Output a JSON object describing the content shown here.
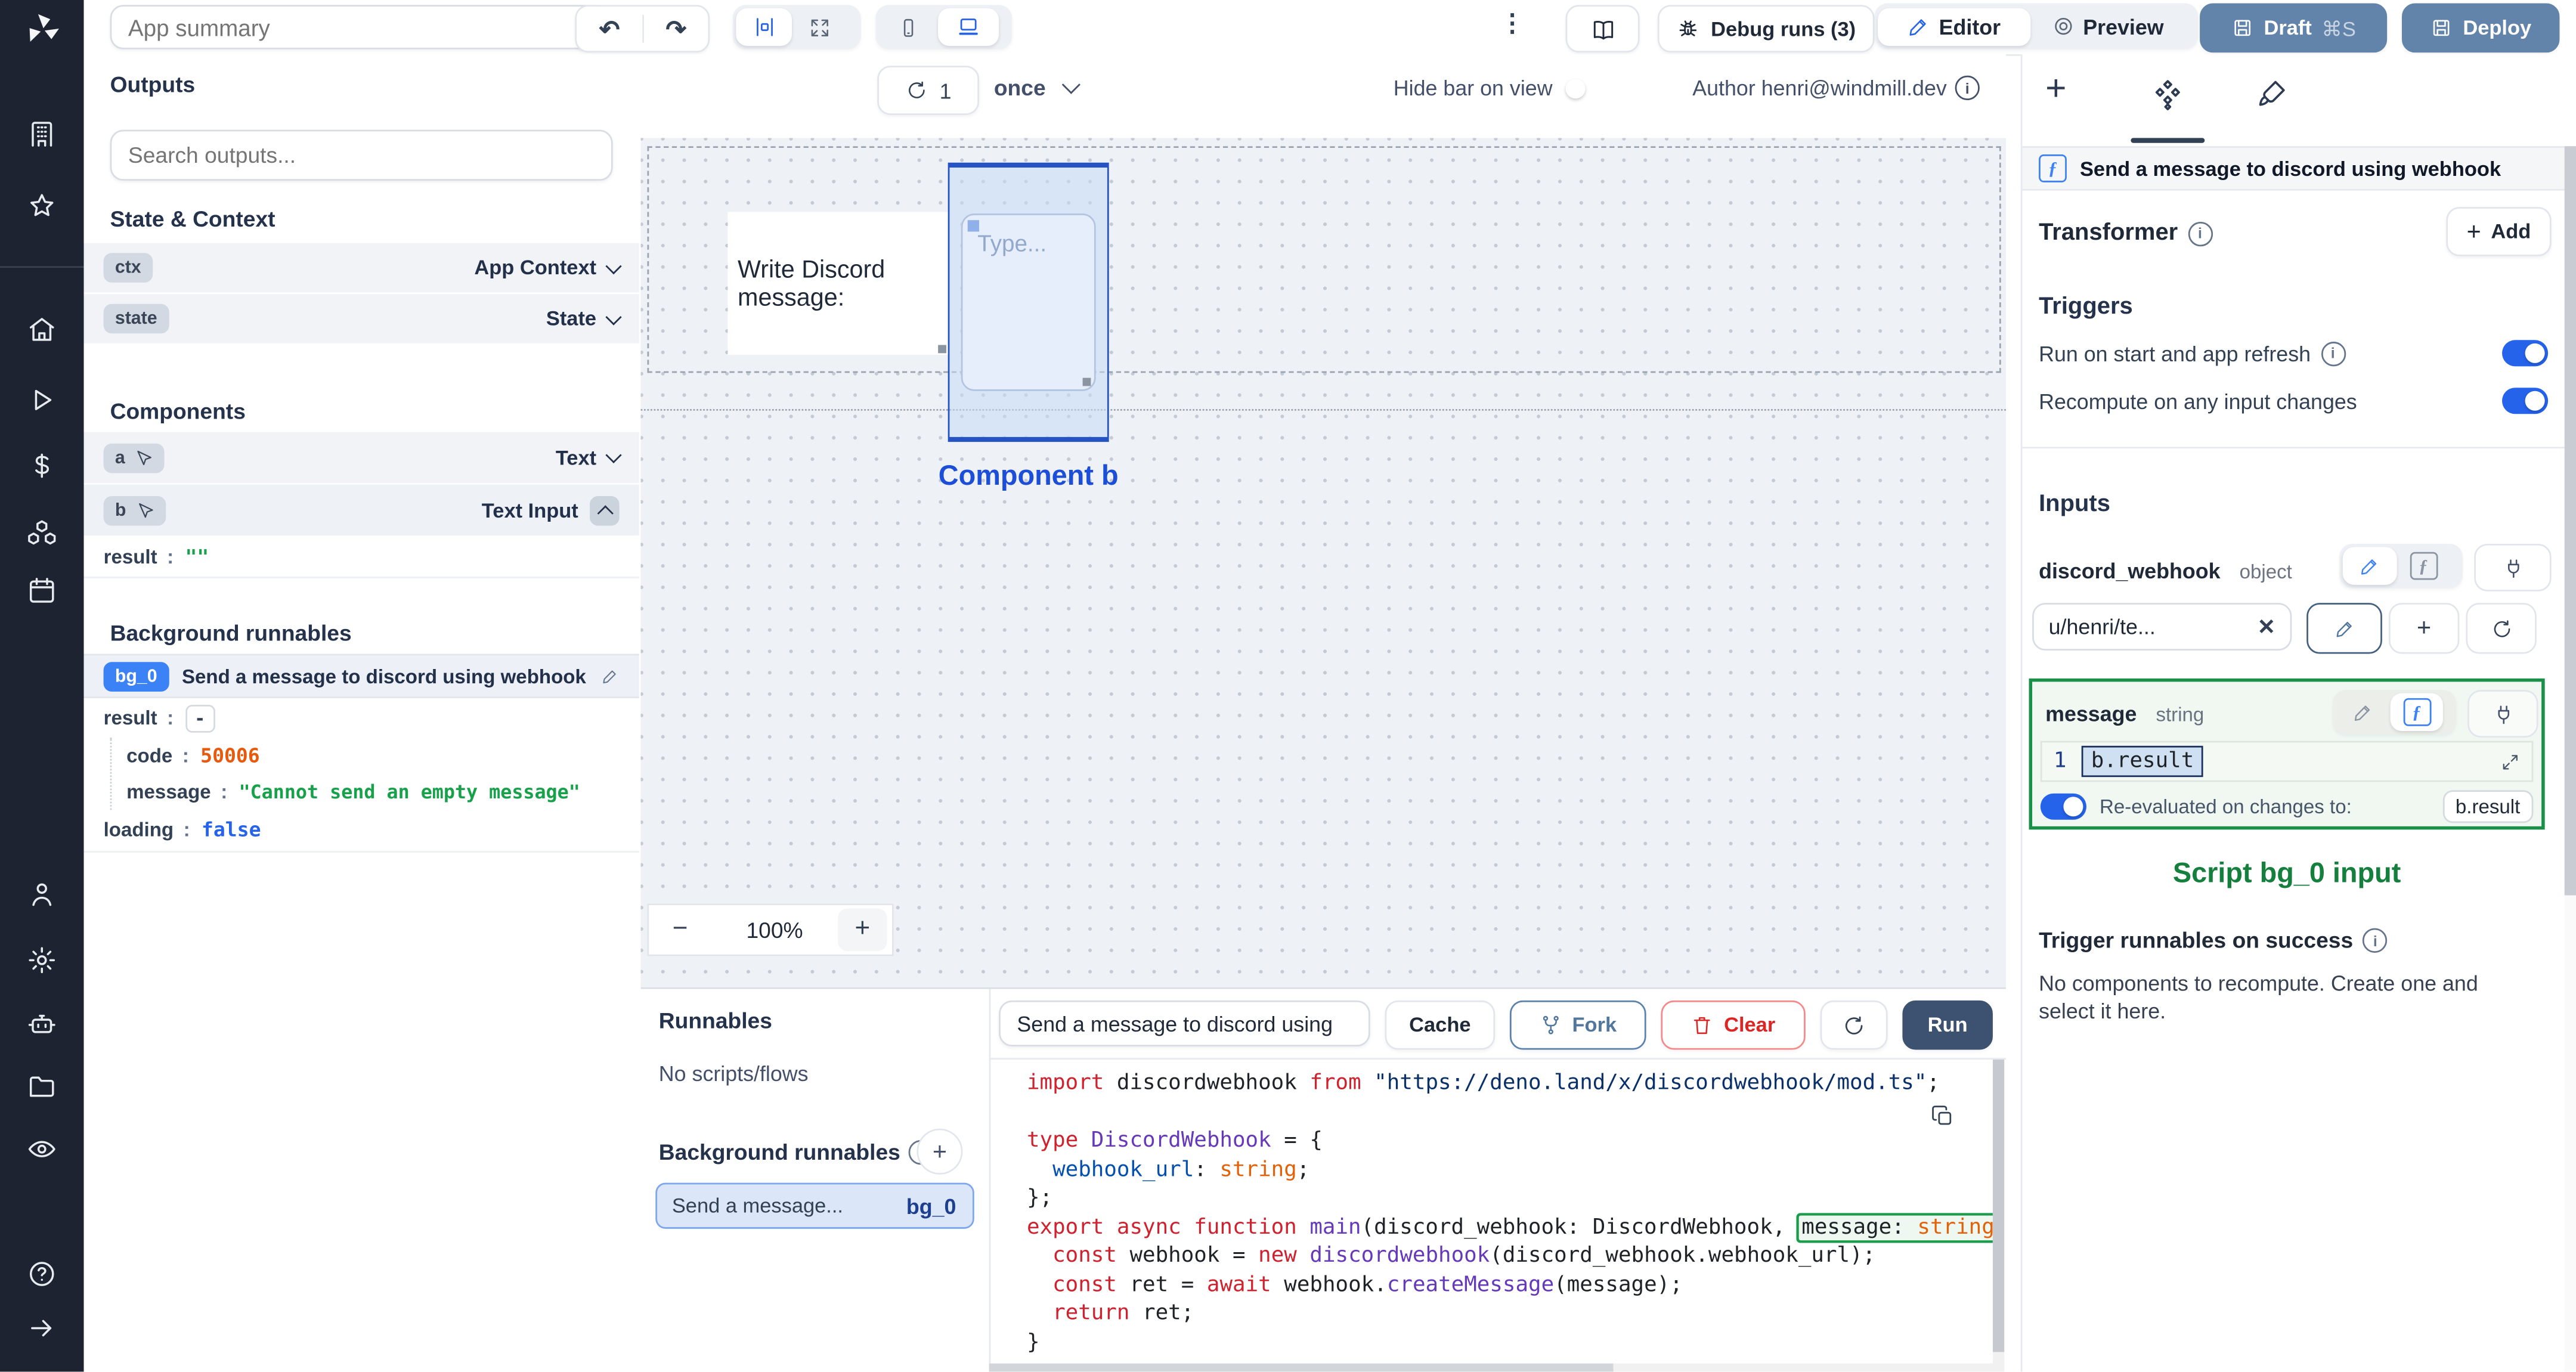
{
  "colors": {
    "accent": "#2563eb",
    "rail_bg": "#1d2330",
    "steel_button": "#6284aa",
    "run_button": "#3d5270",
    "selection_blue": "#2653c3",
    "green_accent": "#15803d",
    "badge_blue": "#3b82f6",
    "value_orange": "#e8590c",
    "value_green": "#18a14b",
    "value_bool_blue": "#2563eb",
    "canvas_bg": "#eef1f5"
  },
  "icons": [
    "windmill-logo-icon",
    "building-icon",
    "star-icon",
    "home-icon",
    "play-icon",
    "dollar-icon",
    "cubes-icon",
    "calendar-icon",
    "user-icon",
    "gear-icon",
    "robot-icon",
    "folder-icon",
    "eye-icon",
    "help-icon",
    "arrow-right-icon",
    "undo-icon",
    "redo-icon",
    "align-center-icon",
    "expand-icon",
    "phone-icon",
    "laptop-icon",
    "kebab-icon",
    "book-icon",
    "bug-icon",
    "pencil-icon",
    "target-icon",
    "save-icon",
    "refresh-icon",
    "chevron-down-icon",
    "chevron-up-icon",
    "pointer-icon",
    "plus-icon",
    "components-icon",
    "brush-icon",
    "function-icon",
    "plug-icon",
    "close-icon",
    "fork-icon",
    "trash-icon",
    "copy-icon",
    "expand-diagonal-icon",
    "info-icon"
  ],
  "topbar": {
    "app_summary_placeholder": "App summary",
    "debug_runs_label": "Debug runs (3)",
    "editor_label": "Editor",
    "preview_label": "Preview",
    "draft_label": "Draft",
    "draft_shortcut": "⌘S",
    "deploy_label": "Deploy"
  },
  "outputs": {
    "title": "Outputs",
    "search_placeholder": "Search outputs...",
    "state_context_title": "State & Context",
    "ctx": {
      "key": "ctx",
      "type": "App Context"
    },
    "state": {
      "key": "state",
      "type": "State"
    },
    "components_title": "Components",
    "comp_a": {
      "key": "a",
      "type": "Text"
    },
    "comp_b": {
      "key": "b",
      "type": "Text Input"
    },
    "b_result": {
      "key": "result",
      "value": "\"\""
    },
    "background_title": "Background runnables",
    "bg0": {
      "badge": "bg_0",
      "title": "Send a message to discord using webhook"
    },
    "bg0_result": {
      "key": "result",
      "value": "-"
    },
    "bg0_code": {
      "key": "code",
      "value": "50006"
    },
    "bg0_message": {
      "key": "message",
      "value": "\"Cannot send an empty message\""
    },
    "bg0_loading": {
      "key": "loading",
      "value": "false"
    }
  },
  "canvas": {
    "refresh_count": "1",
    "run_mode": "once",
    "hide_bar_label": "Hide bar on view",
    "author_label": "Author henri@windmill.dev",
    "text_component": "Write Discord message:",
    "input_placeholder": "Type...",
    "selected_label": "Component b",
    "zoom_out": "−",
    "zoom_level": "100%",
    "zoom_in": "+"
  },
  "runnables": {
    "title": "Runnables",
    "empty": "No scripts/flows",
    "background_title": "Background runnables",
    "item": {
      "label": "Send a message...",
      "badge": "bg_0"
    }
  },
  "editor": {
    "title_value": "Send a message to discord using",
    "cache_label": "Cache",
    "fork_label": "Fork",
    "clear_label": "Clear",
    "run_label": "Run",
    "code_lines": [
      [
        [
          "k",
          "import "
        ],
        [
          "d",
          "discordwebhook "
        ],
        [
          "k",
          "from "
        ],
        [
          "s",
          "\"https://deno.land/x/discordwebhook/mod.ts\""
        ],
        [
          "d",
          ";"
        ]
      ],
      [],
      [
        [
          "k",
          "type "
        ],
        [
          "t",
          "DiscordWebhook"
        ],
        [
          "d",
          " = {"
        ]
      ],
      [
        [
          "d",
          "  "
        ],
        [
          "p",
          "webhook_url"
        ],
        [
          "d",
          ": "
        ],
        [
          "o",
          "string"
        ],
        [
          "d",
          ";"
        ]
      ],
      [
        [
          "d",
          "};"
        ]
      ],
      [
        [
          "k",
          "export async function "
        ],
        [
          "t",
          "main"
        ],
        [
          "d",
          "(discord_webhook: DiscordWebhook, "
        ],
        [
          "hl",
          [
            [
              "d",
              "message: "
            ],
            [
              "o",
              "string"
            ]
          ]
        ]
      ],
      [
        [
          "d",
          "  "
        ],
        [
          "k",
          "const "
        ],
        [
          "d",
          "webhook = "
        ],
        [
          "k",
          "new "
        ],
        [
          "t",
          "discordwebhook"
        ],
        [
          "d",
          "(discord_webhook.webhook_url);"
        ]
      ],
      [
        [
          "d",
          "  "
        ],
        [
          "k",
          "const "
        ],
        [
          "d",
          "ret = "
        ],
        [
          "k",
          "await "
        ],
        [
          "d",
          "webhook."
        ],
        [
          "t",
          "createMessage"
        ],
        [
          "d",
          "(message);"
        ]
      ],
      [
        [
          "d",
          "  "
        ],
        [
          "k",
          "return "
        ],
        [
          "d",
          "ret;"
        ]
      ],
      [
        [
          "d",
          "}"
        ]
      ]
    ]
  },
  "right": {
    "header": "Send a message to discord using webhook",
    "transformer_label": "Transformer",
    "add_label": "Add",
    "triggers_title": "Triggers",
    "run_on_start_label": "Run on start and app refresh",
    "recompute_label": "Recompute on any input changes",
    "inputs_title": "Inputs",
    "discord": {
      "name": "discord_webhook",
      "type": "object",
      "value": "u/henri/te..."
    },
    "message": {
      "name": "message",
      "type": "string",
      "line_no": "1",
      "expr": "b.result"
    },
    "reeval_label": "Re-evaluated on changes to:",
    "reeval_badge": "b.result",
    "script_input_caption": "Script bg_0 input",
    "trigger_success_label": "Trigger runnables on success",
    "empty_text": "No components to recompute. Create one and select it here."
  }
}
